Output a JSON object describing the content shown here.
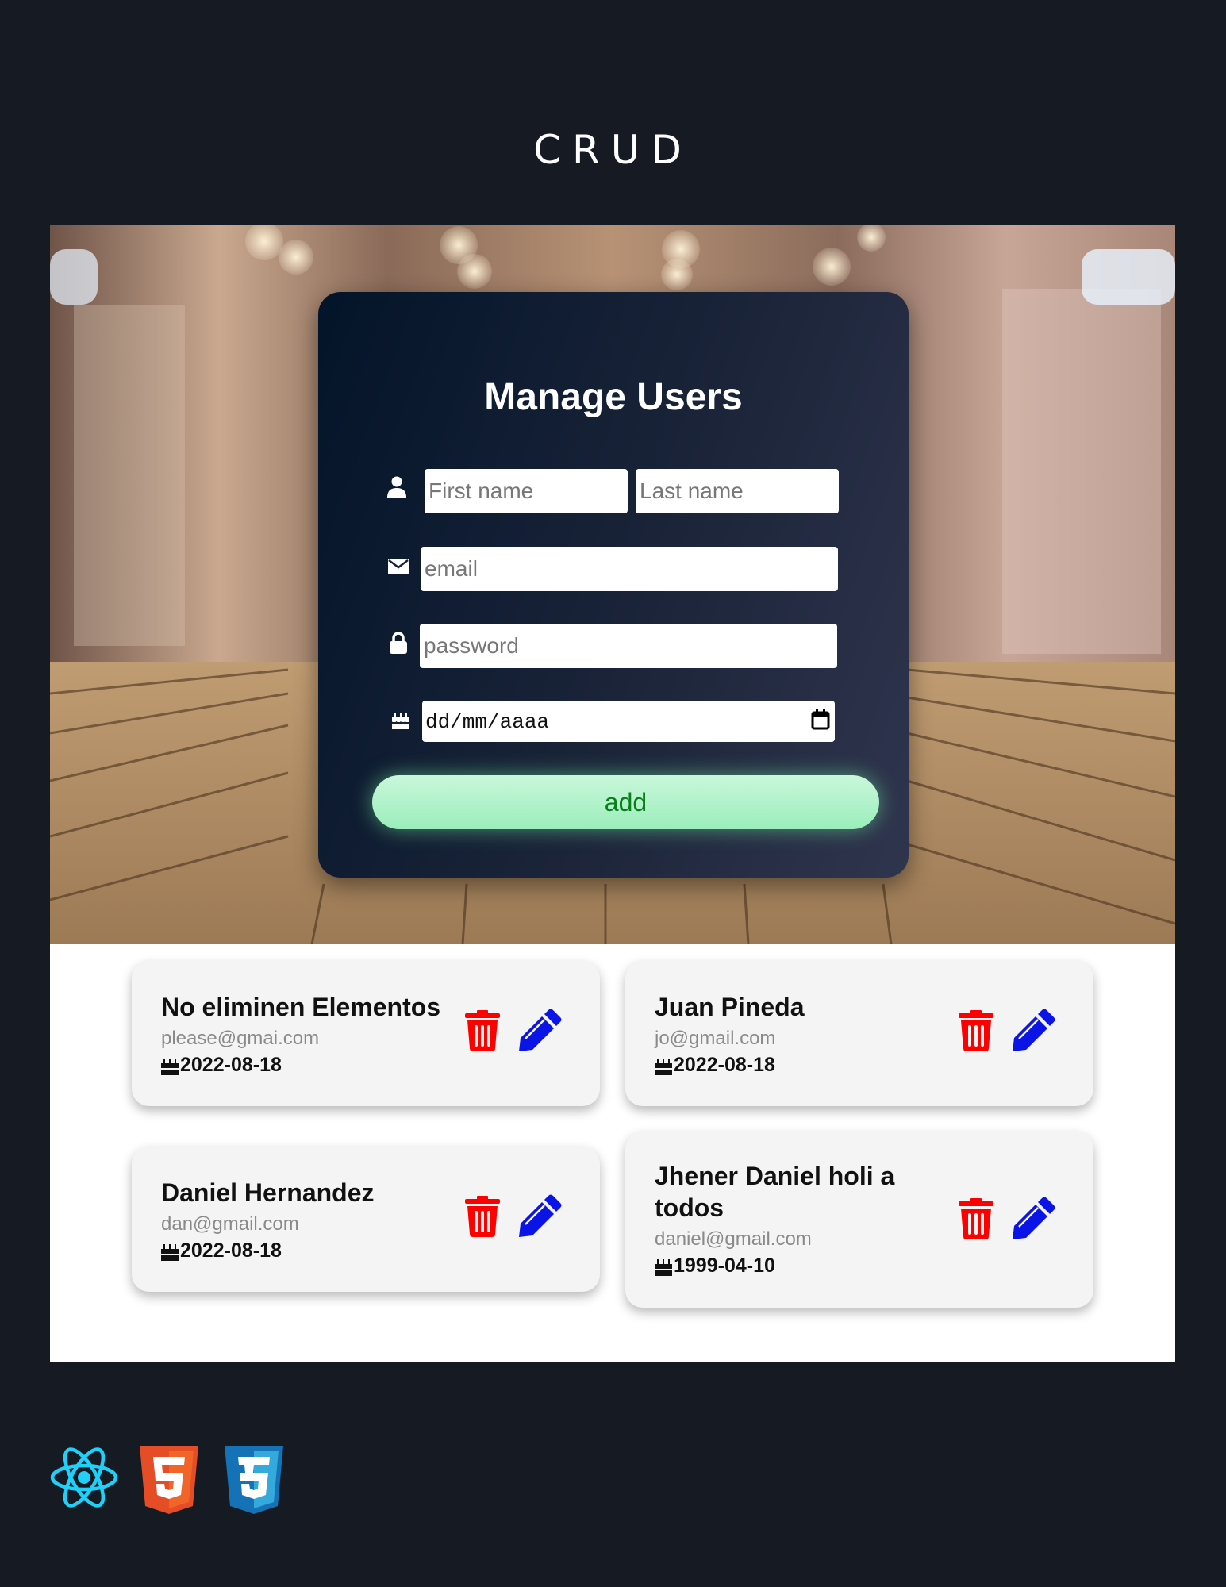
{
  "page": {
    "title": "CRUD"
  },
  "form": {
    "heading": "Manage Users",
    "first_name_placeholder": "First name",
    "last_name_placeholder": "Last name",
    "email_placeholder": "email",
    "password_placeholder": "password",
    "date_placeholder": "dd/mm/aaaa",
    "add_label": "add",
    "icons": [
      "user-icon",
      "envelope-icon",
      "lock-icon",
      "birthday-cake-icon",
      "calendar-icon"
    ]
  },
  "users": [
    {
      "name": "No eliminen Elementos",
      "email": "please@gmai.com",
      "birthdate": "2022-08-18"
    },
    {
      "name": "Juan Pineda",
      "email": "jo@gmail.com",
      "birthdate": "2022-08-18"
    },
    {
      "name": "Daniel Hernandez",
      "email": "dan@gmail.com",
      "birthdate": "2022-08-18"
    },
    {
      "name": "Jhener Daniel holi a todos",
      "email": "daniel@gmail.com",
      "birthdate": "1999-04-10"
    }
  ],
  "card_icons": {
    "delete": "trash-icon",
    "edit": "pencil-icon"
  },
  "footer": {
    "logos": [
      "react-logo",
      "html5-logo",
      "css3-logo"
    ]
  },
  "colors": {
    "background": "#151a23",
    "delete": "#ff0000",
    "edit": "#0a14e6",
    "add": "#9beebb"
  }
}
